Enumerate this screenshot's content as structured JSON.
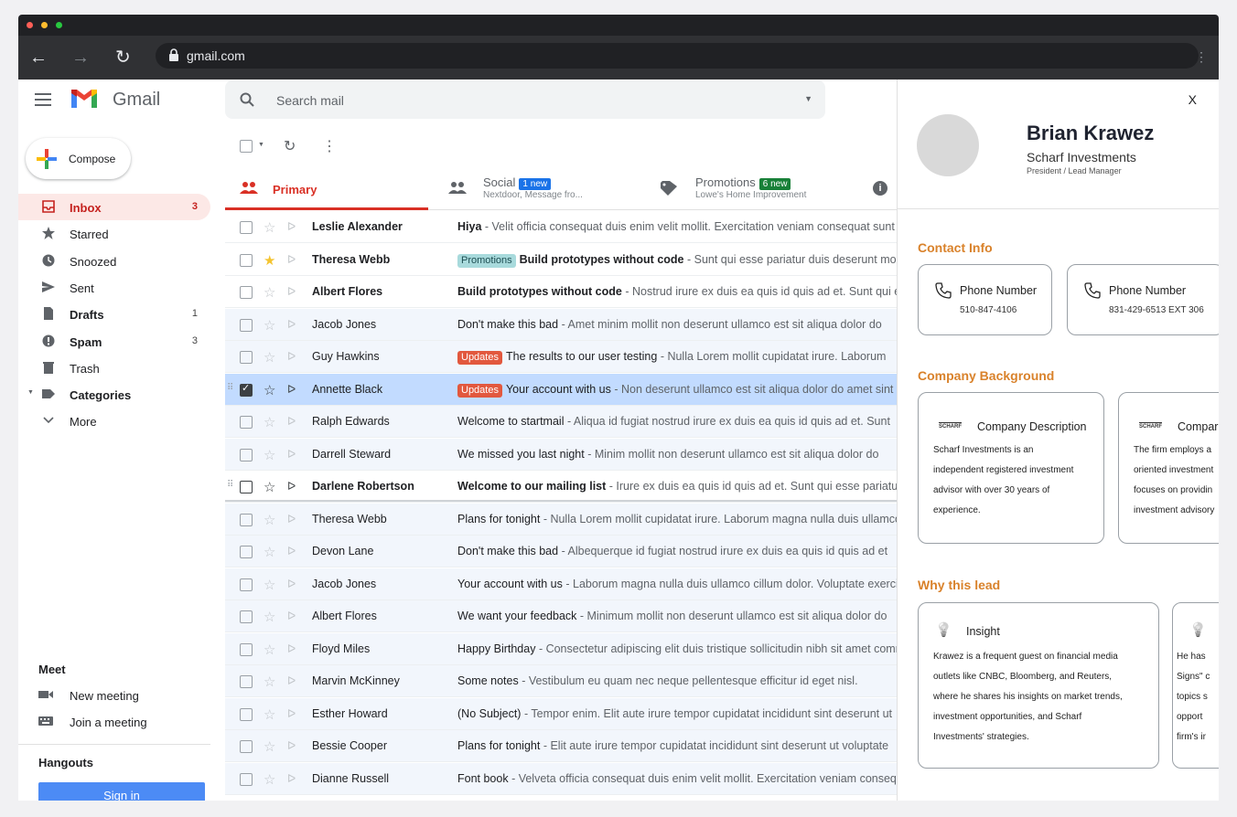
{
  "browser": {
    "url": "gmail.com"
  },
  "app": {
    "name": "Gmail"
  },
  "compose_label": "Compose",
  "search": {
    "placeholder": "Search mail"
  },
  "nav": [
    {
      "label": "Inbox",
      "count": "3",
      "icon": "inbox-icon",
      "active": true,
      "bold": true
    },
    {
      "label": "Starred",
      "count": "",
      "icon": "star-icon"
    },
    {
      "label": "Snoozed",
      "count": "",
      "icon": "clock-icon"
    },
    {
      "label": "Sent",
      "count": "",
      "icon": "send-icon"
    },
    {
      "label": "Drafts",
      "count": "1",
      "icon": "draft-icon",
      "bold": true
    },
    {
      "label": "Spam",
      "count": "3",
      "icon": "spam-icon",
      "bold": true
    },
    {
      "label": "Trash",
      "count": "",
      "icon": "trash-icon"
    },
    {
      "label": "Categories",
      "count": "",
      "icon": "label-icon",
      "bold": true
    },
    {
      "label": "More",
      "count": "",
      "icon": "chevron-down-icon"
    }
  ],
  "meet": {
    "title": "Meet",
    "new_meeting": "New meeting",
    "join_meeting": "Join a meeting"
  },
  "hangouts": {
    "title": "Hangouts",
    "sign_in": "Sign in"
  },
  "tabs": [
    {
      "label": "Primary",
      "sub": "",
      "badge": ""
    },
    {
      "label": "Social",
      "sub": "Nextdoor, Message fro...",
      "badge": "1 new",
      "badge_color": "#1a73e8"
    },
    {
      "label": "Promotions",
      "sub": "Lowe's Home Improvement",
      "badge": "6 new",
      "badge_color": "#188038"
    }
  ],
  "emails": [
    {
      "sender": "Leslie Alexander",
      "subject": "Hiya",
      "snippet": " - Velit officia consequat duis enim velit mollit. Exercitation veniam consequat sunt",
      "unread": true,
      "starred": false,
      "label": ""
    },
    {
      "sender": "Theresa Webb",
      "subject": "Build prototypes without code",
      "snippet": " - Sunt qui esse pariatur duis deserunt mollit",
      "unread": true,
      "starred": true,
      "label": "Promotions"
    },
    {
      "sender": "Albert Flores",
      "subject": "Build prototypes without code",
      "snippet": " - Nostrud irure ex duis ea quis id quis ad et. Sunt qui esse",
      "unread": true,
      "starred": false,
      "label": ""
    },
    {
      "sender": "Jacob Jones",
      "subject": "Don't make this bad",
      "snippet": " - Amet minim mollit non deserunt ullamco est sit aliqua dolor do",
      "unread": false,
      "starred": false,
      "label": ""
    },
    {
      "sender": "Guy Hawkins",
      "subject": "The results to our user testing",
      "snippet": " - Nulla Lorem mollit cupidatat irure. Laborum",
      "unread": false,
      "starred": false,
      "label": "Updates"
    },
    {
      "sender": "Annette Black",
      "subject": "Your account with us",
      "snippet": " - Non deserunt ullamco est sit aliqua dolor do amet sint",
      "unread": false,
      "starred": false,
      "label": "Updates",
      "selected": true
    },
    {
      "sender": "Ralph Edwards",
      "subject": "Welcome to startmail",
      "snippet": " - Aliqua id fugiat nostrud irure ex duis ea quis id quis ad et. Sunt",
      "unread": false,
      "starred": false,
      "label": ""
    },
    {
      "sender": "Darrell Steward",
      "subject": "We missed you last night",
      "snippet": " - Minim mollit non deserunt ullamco est sit aliqua dolor do",
      "unread": false,
      "starred": false,
      "label": ""
    },
    {
      "sender": "Darlene Robertson",
      "subject": "Welcome to our mailing list",
      "snippet": " - Irure ex duis ea quis id quis ad et. Sunt qui esse pariatur",
      "unread": true,
      "starred": false,
      "label": "",
      "hover": true
    },
    {
      "sender": "Theresa Webb",
      "subject": "Plans for tonight",
      "snippet": " - Nulla Lorem mollit cupidatat irure. Laborum magna nulla duis ullamco",
      "unread": false,
      "starred": false,
      "label": ""
    },
    {
      "sender": "Devon Lane",
      "subject": "Don't make this bad",
      "snippet": " - Albequerque id fugiat nostrud irure ex duis ea quis id quis ad et",
      "unread": false,
      "starred": false,
      "label": ""
    },
    {
      "sender": "Jacob Jones",
      "subject": "Your account with us",
      "snippet": " - Laborum magna nulla duis ullamco cillum dolor. Voluptate exercitation",
      "unread": false,
      "starred": false,
      "label": ""
    },
    {
      "sender": "Albert Flores",
      "subject": "We want your feedback",
      "snippet": " - Minimum mollit non deserunt ullamco est sit aliqua dolor do",
      "unread": false,
      "starred": false,
      "label": ""
    },
    {
      "sender": "Floyd Miles",
      "subject": "Happy Birthday",
      "snippet": " - Consectetur adipiscing elit duis tristique sollicitudin nibh sit amet commodo",
      "unread": false,
      "starred": false,
      "label": ""
    },
    {
      "sender": "Marvin McKinney",
      "subject": "Some notes",
      "snippet": " - Vestibulum eu quam nec neque pellentesque efficitur id eget nisl.",
      "unread": false,
      "starred": false,
      "label": ""
    },
    {
      "sender": "Esther Howard",
      "subject": "(No Subject)",
      "snippet": " - Tempor enim. Elit aute irure tempor cupidatat incididunt sint deserunt ut",
      "unread": false,
      "starred": false,
      "label": ""
    },
    {
      "sender": "Bessie Cooper",
      "subject": "Plans for tonight",
      "snippet": " - Elit aute irure tempor cupidatat incididunt sint deserunt ut voluptate",
      "unread": false,
      "starred": false,
      "label": ""
    },
    {
      "sender": "Dianne Russell",
      "subject": "Font book",
      "snippet": " - Velveta officia consequat duis enim velit mollit. Exercitation veniam consequat",
      "unread": false,
      "starred": false,
      "label": ""
    }
  ],
  "label_colors": {
    "Promotions": {
      "bg": "#a8dadc",
      "fg": "#1d4e52"
    },
    "Updates": {
      "bg": "#e2583e",
      "fg": "#ffffff"
    }
  },
  "panel": {
    "close": "X",
    "name": "Brian Krawez",
    "company": "Scharf Investments",
    "title": "President / Lead Manager",
    "contact_heading": "Contact Info",
    "phones": [
      {
        "label": "Phone Number",
        "value": "510-847-4106"
      },
      {
        "label": "Phone Number",
        "value": "831-429-6513 EXT 306"
      }
    ],
    "background_heading": "Company Background",
    "company_cards": [
      {
        "logo_text": "SCHARF",
        "title": "Company Description",
        "lines": [
          "Scharf Investments is an",
          "independent registered investment",
          "advisor with over 30 years of",
          "experience."
        ]
      },
      {
        "logo_text": "SCHARF",
        "title": "Compar",
        "lines": [
          "The firm employs a",
          "oriented investment",
          "focuses on providin",
          "investment advisory"
        ]
      }
    ],
    "why_heading": "Why this lead",
    "insight_cards": [
      {
        "title": "Insight",
        "lines": [
          "Krawez is a frequent guest on financial media",
          "outlets like CNBC, Bloomberg, and Reuters,",
          "where he shares his insights on market trends,",
          "investment opportunities, and Scharf",
          "Investments' strategies."
        ]
      },
      {
        "title": "",
        "lines": [
          "He has",
          "Signs\" c",
          "topics s",
          "opport",
          "firm's ir"
        ]
      }
    ]
  },
  "colors": {
    "accent_red": "#c5221f",
    "panel_accent": "#d9822b",
    "selected_row": "#c2dbff"
  }
}
